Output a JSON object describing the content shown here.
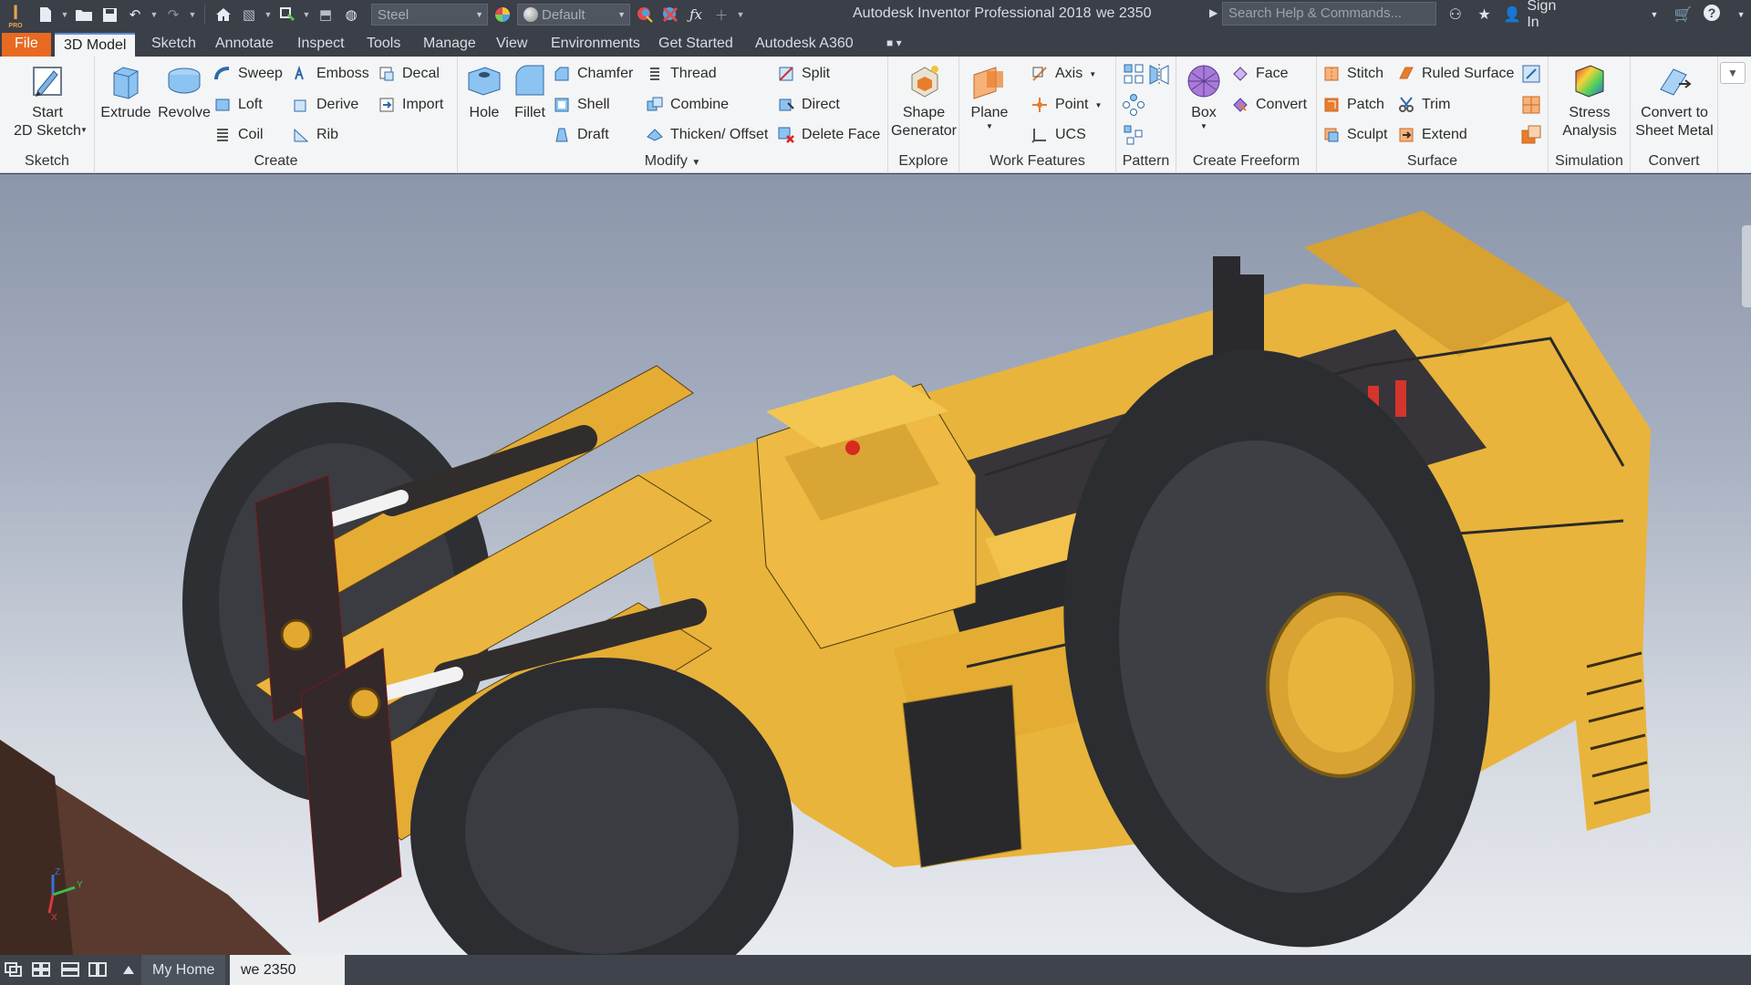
{
  "app": {
    "title": "Autodesk Inventor Professional 2018",
    "document": "we 2350",
    "logo": "I",
    "logo_sub": "PRO"
  },
  "quick_access": {
    "material": "Steel",
    "appearance": "Default"
  },
  "search": {
    "placeholder": "Search Help & Commands..."
  },
  "user": {
    "sign_in": "Sign In"
  },
  "menu_tabs": [
    {
      "label": "File"
    },
    {
      "label": "3D Model"
    },
    {
      "label": "Sketch"
    },
    {
      "label": "Annotate"
    },
    {
      "label": "Inspect"
    },
    {
      "label": "Tools"
    },
    {
      "label": "Manage"
    },
    {
      "label": "View"
    },
    {
      "label": "Environments"
    },
    {
      "label": "Get Started"
    },
    {
      "label": "Autodesk A360"
    }
  ],
  "ribbon": {
    "sketch": {
      "label": "Sketch",
      "start_line1": "Start",
      "start_line2": "2D Sketch"
    },
    "create": {
      "label": "Create",
      "extrude": "Extrude",
      "revolve": "Revolve",
      "sweep": "Sweep",
      "loft": "Loft",
      "coil": "Coil",
      "emboss": "Emboss",
      "derive": "Derive",
      "rib": "Rib",
      "decal": "Decal",
      "import": "Import"
    },
    "modify": {
      "label": "Modify",
      "hole": "Hole",
      "fillet": "Fillet",
      "chamfer": "Chamfer",
      "shell": "Shell",
      "draft": "Draft",
      "thread": "Thread",
      "combine": "Combine",
      "thicken": "Thicken/ Offset",
      "split": "Split",
      "direct": "Direct",
      "delete_face": "Delete Face"
    },
    "explore": {
      "label": "Explore",
      "shape_line1": "Shape",
      "shape_line2": "Generator"
    },
    "work_features": {
      "label": "Work Features",
      "plane": "Plane",
      "axis": "Axis",
      "point": "Point",
      "ucs": "UCS"
    },
    "pattern": {
      "label": "Pattern"
    },
    "freeform": {
      "label": "Create Freeform",
      "box": "Box",
      "face": "Face",
      "convert": "Convert"
    },
    "surface": {
      "label": "Surface",
      "stitch": "Stitch",
      "patch": "Patch",
      "sculpt": "Sculpt",
      "ruled": "Ruled Surface",
      "trim": "Trim",
      "extend": "Extend"
    },
    "simulation": {
      "label": "Simulation",
      "stress_line1": "Stress",
      "stress_line2": "Analysis"
    },
    "convert": {
      "label": "Convert",
      "sheet_line1": "Convert to",
      "sheet_line2": "Sheet Metal"
    }
  },
  "triad": {
    "y": "Y",
    "z": "Z",
    "x": "X"
  },
  "status_bar": {
    "home_tab": "My Home",
    "doc_tab": "we 2350 .ipt",
    "close_glyph": "✕"
  },
  "colors": {
    "accent": "#e86a21",
    "body_yellow": "#e9b43c",
    "tire": "#2d2f33"
  }
}
